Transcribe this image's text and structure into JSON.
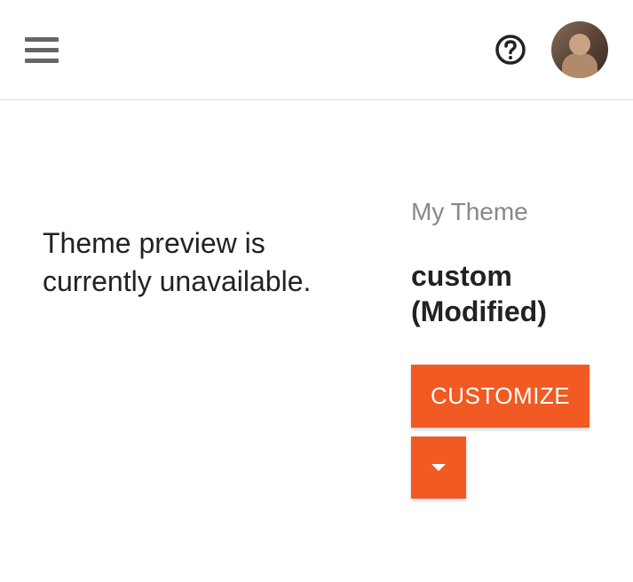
{
  "preview": {
    "unavailable_text": "Theme preview is currently unavailable."
  },
  "theme": {
    "section_label": "My Theme",
    "name": "custom (Modified)",
    "customize_label": "CUSTOMIZE"
  }
}
